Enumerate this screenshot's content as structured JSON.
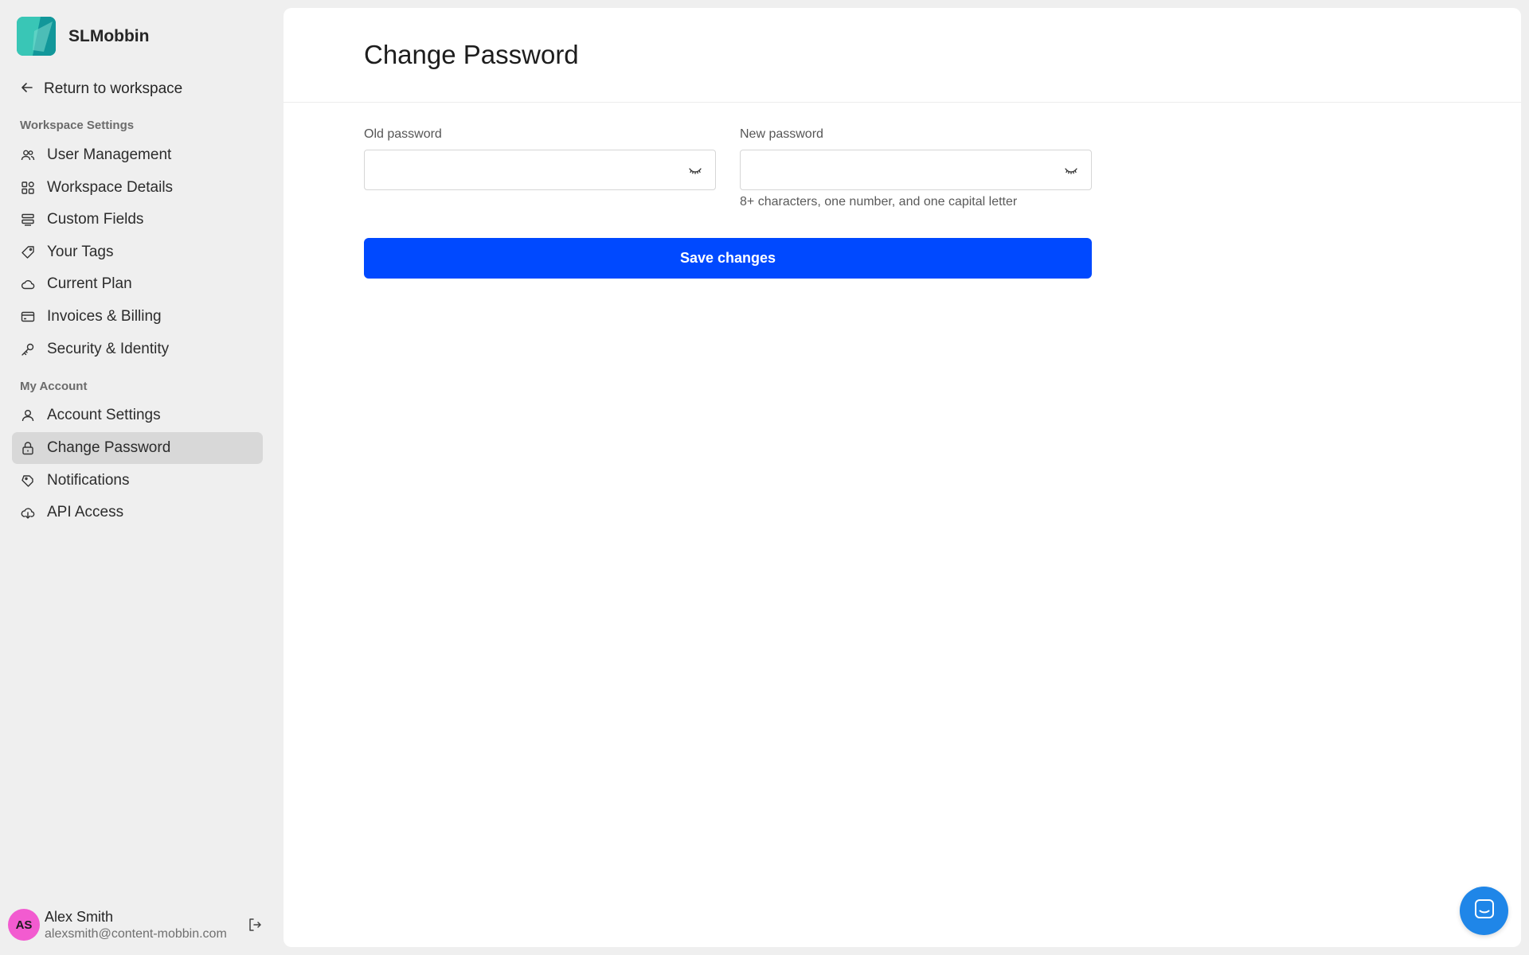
{
  "brand": {
    "name": "SLMobbin"
  },
  "sidebar": {
    "return_label": "Return to workspace",
    "workspace_section": "Workspace Settings",
    "workspace_items": [
      {
        "label": "User Management",
        "icon": "users-icon"
      },
      {
        "label": "Workspace Details",
        "icon": "grid-icon"
      },
      {
        "label": "Custom Fields",
        "icon": "fields-icon"
      },
      {
        "label": "Your Tags",
        "icon": "tag-icon"
      },
      {
        "label": "Current Plan",
        "icon": "cloud-icon"
      },
      {
        "label": "Invoices & Billing",
        "icon": "card-icon"
      },
      {
        "label": "Security & Identity",
        "icon": "key-icon"
      }
    ],
    "account_section": "My Account",
    "account_items": [
      {
        "label": "Account Settings",
        "icon": "user-icon"
      },
      {
        "label": "Change Password",
        "icon": "lock-icon",
        "active": true
      },
      {
        "label": "Notifications",
        "icon": "bell-icon"
      },
      {
        "label": "API Access",
        "icon": "cloud-download-icon"
      }
    ]
  },
  "user": {
    "initials": "AS",
    "name": "Alex Smith",
    "email": "alexsmith@content-mobbin.com"
  },
  "main": {
    "title": "Change Password",
    "old_password": {
      "label": "Old password",
      "value": ""
    },
    "new_password": {
      "label": "New password",
      "value": "",
      "hint": "8+ characters, one number, and one capital letter"
    },
    "save_label": "Save changes"
  },
  "colors": {
    "primary": "#0049ff",
    "sidebar_bg": "#efefef",
    "active_item": "#d8d8d8",
    "avatar": "#f25bd0",
    "chat_fab": "#1f86e8"
  }
}
